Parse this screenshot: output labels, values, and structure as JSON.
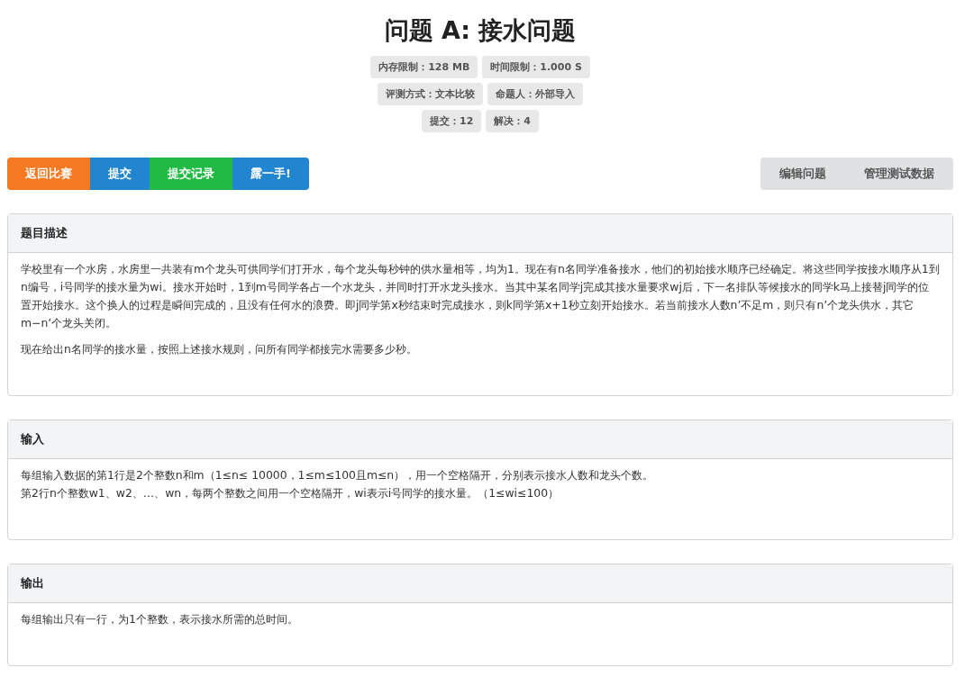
{
  "title": "问题 A: 接水问题",
  "info_rows": [
    [
      "内存限制：128 MB",
      "时间限制：1.000 S"
    ],
    [
      "评测方式：文本比较",
      "命题人：外部导入"
    ],
    [
      "提交：12",
      "解决：4"
    ]
  ],
  "action_buttons": [
    {
      "label": "返回比赛",
      "color": "#f47920"
    },
    {
      "label": "提交",
      "color": "#2185d0"
    },
    {
      "label": "提交记录",
      "color": "#21ba45"
    },
    {
      "label": "露一手!",
      "color": "#2185d0"
    }
  ],
  "admin_buttons": [
    "编辑问题",
    "管理测试数据"
  ],
  "sections": [
    {
      "heading": "题目描述",
      "paragraphs": [
        [
          "学校里有一个水房，水房里一共装有m个龙头可供同学们打开水，每个龙头每秒钟的供水量相等，均为1。现在有n名同学准备接水，他们的初始接水顺序已经确定。将这些同学按接水顺序从1到n编号，i号同学的接水量为wi。接水开始时，1到m号同学各占一个水龙头，并同时打开水龙头接水。当其中某名同学j完成其接水量要求wj后，下一名排队等候接水的同学k马上接替j同学的位置开始接水。这个换人的过程是瞬间完成的，且没有任何水的浪费。即j同学第x秒结束时完成接水，则k同学第x+1秒立刻开始接水。若当前接水人数n’不足m，则只有n’个龙头供水，其它m−n’个龙头关闭。"
        ],
        [
          "现在给出n名同学的接水量，按照上述接水规则，问所有同学都接完水需要多少秒。"
        ]
      ]
    },
    {
      "heading": "输入",
      "paragraphs": [
        [
          "每组输入数据的第1行是2个整数n和m（1≤n≤ 10000，1≤m≤100且m≤n），用一个空格隔开，分别表示接水人数和龙头个数。",
          "第2行n个整数w1、w2、…、wn，每两个整数之间用一个空格隔开，wi表示i号同学的接水量。（1≤wi≤100）"
        ]
      ]
    },
    {
      "heading": "输出",
      "paragraphs": [
        [
          "每组输出只有一行，为1个整数，表示接水所需的总时间。"
        ]
      ]
    }
  ]
}
